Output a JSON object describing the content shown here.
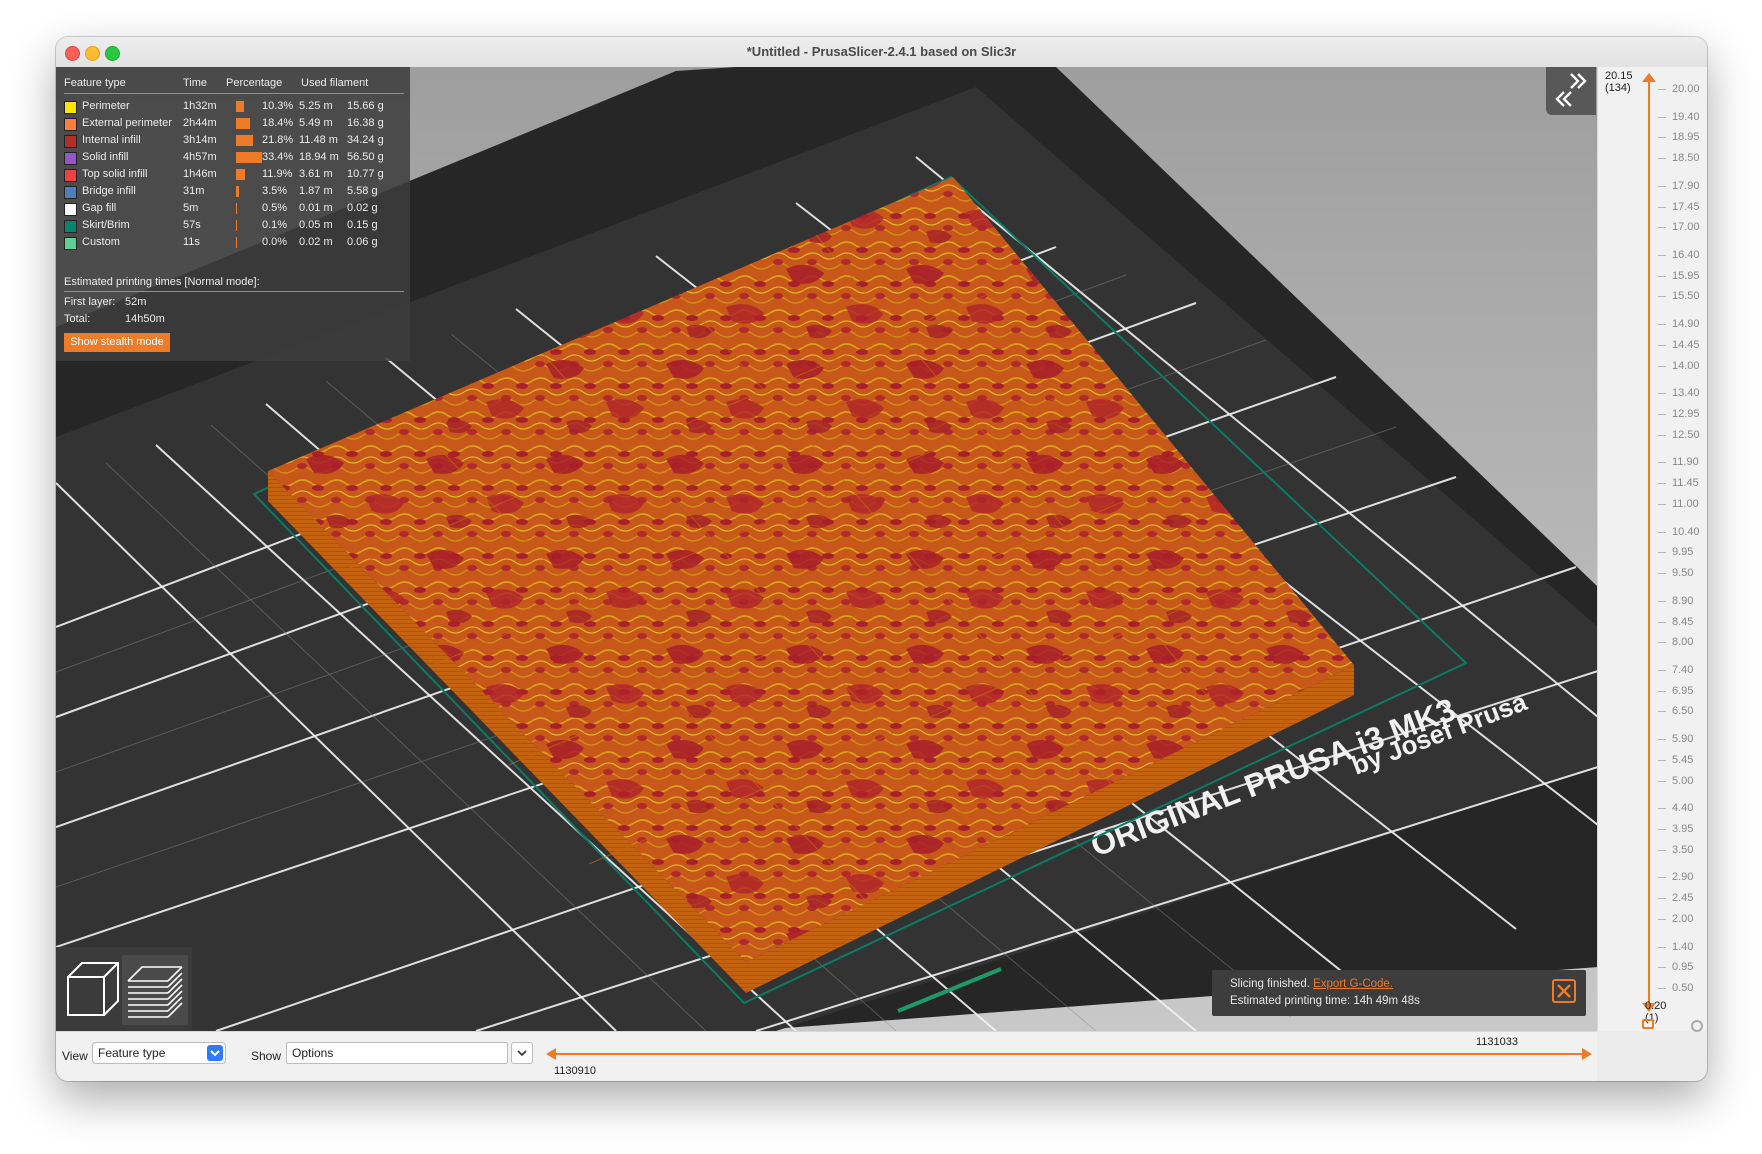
{
  "window": {
    "title": "*Untitled - PrusaSlicer-2.4.1 based on Slic3r"
  },
  "legend": {
    "headers": {
      "feature_type": "Feature type",
      "time": "Time",
      "percentage": "Percentage",
      "used_filament": "Used filament"
    },
    "rows": [
      {
        "name": "Perimeter",
        "color": "#FFE600",
        "time": "1h32m",
        "percent": "10.3%",
        "percent_value": 10.3,
        "length": "5.25 m",
        "weight": "15.66 g"
      },
      {
        "name": "External perimeter",
        "color": "#FF7D38",
        "time": "2h44m",
        "percent": "18.4%",
        "percent_value": 18.4,
        "length": "5.49 m",
        "weight": "16.38 g"
      },
      {
        "name": "Internal infill",
        "color": "#B03029",
        "time": "3h14m",
        "percent": "21.8%",
        "percent_value": 21.8,
        "length": "11.48 m",
        "weight": "34.24 g"
      },
      {
        "name": "Solid infill",
        "color": "#9654CC",
        "time": "4h57m",
        "percent": "33.4%",
        "percent_value": 33.4,
        "length": "18.94 m",
        "weight": "56.50 g"
      },
      {
        "name": "Top solid infill",
        "color": "#F04040",
        "time": "1h46m",
        "percent": "11.9%",
        "percent_value": 11.9,
        "length": "3.61 m",
        "weight": "10.77 g"
      },
      {
        "name": "Bridge infill",
        "color": "#4D80BA",
        "time": "31m",
        "percent": "3.5%",
        "percent_value": 3.5,
        "length": "1.87 m",
        "weight": "5.58 g"
      },
      {
        "name": "Gap fill",
        "color": "#FFFFFF",
        "time": "5m",
        "percent": "0.5%",
        "percent_value": 0.5,
        "length": "0.01 m",
        "weight": "0.02 g"
      },
      {
        "name": "Skirt/Brim",
        "color": "#00876E",
        "time": "57s",
        "percent": "0.1%",
        "percent_value": 0.1,
        "length": "0.05 m",
        "weight": "0.15 g"
      },
      {
        "name": "Custom",
        "color": "#5ED194",
        "time": "11s",
        "percent": "0.0%",
        "percent_value": 0.0,
        "length": "0.02 m",
        "weight": "0.06 g"
      }
    ],
    "estimated_label": "Estimated printing times [Normal mode]:",
    "first_layer_label": "First layer:",
    "first_layer_value": "52m",
    "total_label": "Total:",
    "total_value": "14h50m",
    "stealth_button": "Show stealth mode"
  },
  "bed_text": {
    "line1": "ORIGINAL PRUSA i3  MK3",
    "line2": "by Josef Prusa"
  },
  "notification": {
    "status": "Slicing finished.",
    "link": "Export G-Code.",
    "estimated": "Estimated printing time: 14h 49m 48s"
  },
  "vertical_slider": {
    "top_value": "20.15",
    "top_layer": "(134)",
    "bottom_value": "0.20",
    "bottom_layer": "(1)",
    "ticks": [
      "20.00",
      "19.40",
      "18.95",
      "18.50",
      "17.90",
      "17.45",
      "17.00",
      "16.40",
      "15.95",
      "15.50",
      "14.90",
      "14.45",
      "14.00",
      "13.40",
      "12.95",
      "12.50",
      "11.90",
      "11.45",
      "11.00",
      "10.40",
      "9.95",
      "9.50",
      "8.90",
      "8.45",
      "8.00",
      "7.40",
      "6.95",
      "6.50",
      "5.90",
      "5.45",
      "5.00",
      "4.40",
      "3.95",
      "3.50",
      "2.90",
      "2.45",
      "2.00",
      "1.40",
      "0.95",
      "0.50"
    ]
  },
  "bottom_bar": {
    "view_label": "View",
    "view_value": "Feature type",
    "show_label": "Show",
    "show_value": "Options",
    "slider_left": "1130910",
    "slider_right": "1131033"
  },
  "colors": {
    "accent": "#EE7B28",
    "bed": "#2E2E2E",
    "model_orange": "#C85A12"
  },
  "icons": {
    "collapse": "collapse-sidebar-icon",
    "view_3d": "cube-view-icon",
    "preview": "layers-view-icon",
    "close_notification": "close-icon",
    "lock": "lock-icon",
    "settings": "cog-icon"
  }
}
